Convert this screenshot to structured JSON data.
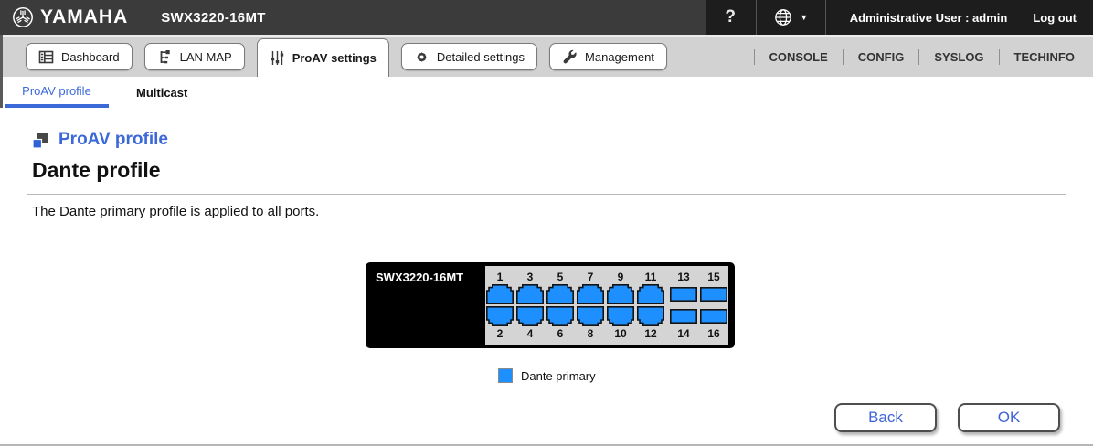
{
  "colors": {
    "accent_blue": "#3c69d8",
    "port_blue": "#1e8fff",
    "header_bg": "#3b3b3b",
    "header_right_bg": "#1d1d1d",
    "tabbar_bg": "#d2d2d2",
    "switch_panel_gray": "#d4d4d4"
  },
  "header": {
    "brand": "YAMAHA",
    "model": "SWX3220-16MT",
    "help_label": "?",
    "user_label": "Administrative User : admin",
    "logout_label": "Log out"
  },
  "tabs": [
    {
      "label": "Dashboard",
      "icon": "dashboard-icon",
      "active": false
    },
    {
      "label": "LAN MAP",
      "icon": "lan-map-icon",
      "active": false
    },
    {
      "label": "ProAV settings",
      "icon": "sliders-icon",
      "active": true
    },
    {
      "label": "Detailed settings",
      "icon": "gear-icon",
      "active": false
    },
    {
      "label": "Management",
      "icon": "wrench-icon",
      "active": false
    }
  ],
  "quick_links": [
    "CONSOLE",
    "CONFIG",
    "SYSLOG",
    "TECHINFO"
  ],
  "subtabs": [
    {
      "label": "ProAV profile",
      "active": true
    },
    {
      "label": "Multicast",
      "active": false
    }
  ],
  "page": {
    "section_title": "ProAV profile",
    "heading": "Dante profile",
    "description": "The Dante primary profile is applied to all ports."
  },
  "switch_graphic": {
    "model_label": "SWX3220-16MT",
    "columns": [
      {
        "top": "1",
        "bottom": "2",
        "type": "rj45"
      },
      {
        "top": "3",
        "bottom": "4",
        "type": "rj45"
      },
      {
        "top": "5",
        "bottom": "6",
        "type": "rj45"
      },
      {
        "top": "7",
        "bottom": "8",
        "type": "rj45"
      },
      {
        "top": "9",
        "bottom": "10",
        "type": "rj45"
      },
      {
        "top": "11",
        "bottom": "12",
        "type": "rj45"
      },
      {
        "top": "13",
        "bottom": "14",
        "type": "sfp"
      },
      {
        "top": "15",
        "bottom": "16",
        "type": "sfp"
      }
    ],
    "port_profile": "Dante primary"
  },
  "legend": {
    "label": "Dante primary",
    "color": "#1e8fff"
  },
  "buttons": {
    "back": "Back",
    "ok": "OK"
  }
}
